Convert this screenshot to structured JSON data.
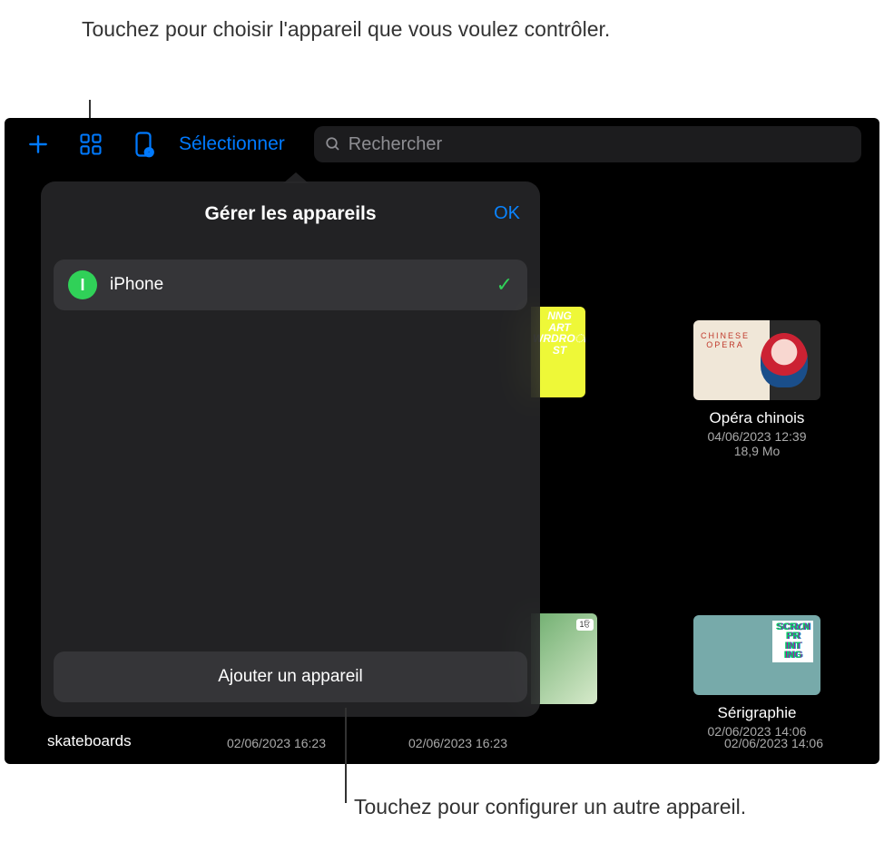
{
  "callouts": {
    "top": "Touchez pour choisir l'appareil que vous voulez contrôler.",
    "bottom": "Touchez pour configurer un autre appareil."
  },
  "toolbar": {
    "add_icon": "plus-icon",
    "grid_icon": "apps-grid-icon",
    "device_icon": "device-play-icon",
    "select_label": "Sélectionner",
    "search_placeholder": "Rechercher",
    "search_icon": "search-icon"
  },
  "popover": {
    "title": "Gérer les appareils",
    "ok": "OK",
    "devices": [
      {
        "badge": "I",
        "name": "iPhone",
        "selected": true
      }
    ],
    "add_label": "Ajouter un appareil"
  },
  "grid": {
    "items": [
      {
        "id": "opera",
        "title": "Opéra chinois",
        "date": "04/06/2023 12:39",
        "size": "18,9 Mo"
      },
      {
        "id": "seri",
        "title": "Sérigraphie",
        "date": "02/06/2023 14:06",
        "size": ""
      }
    ],
    "bottom_labels": {
      "skateboards": "skateboards",
      "d1": "02/06/2023 16:23",
      "d2": "02/06/2023 16:23"
    }
  }
}
